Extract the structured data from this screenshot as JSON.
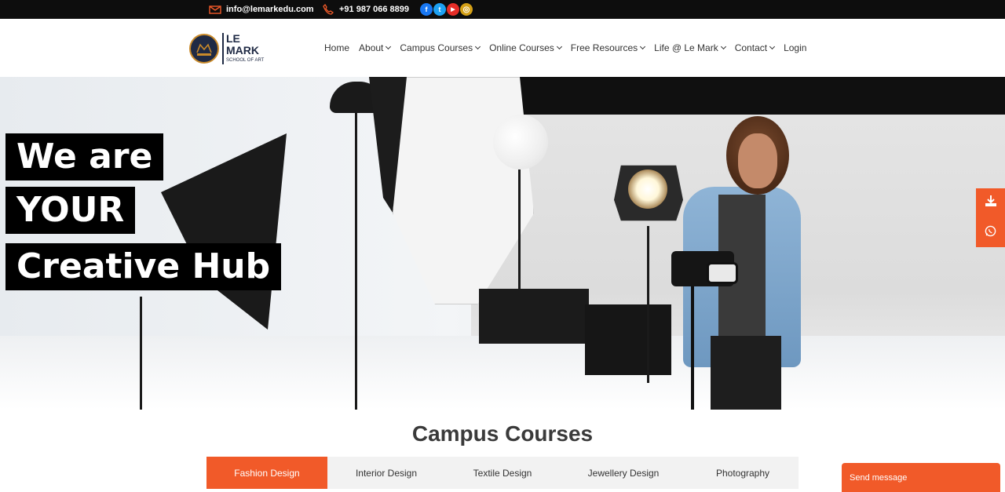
{
  "topbar": {
    "email": "info@lemarkedu.com",
    "phone": "+91 987 066 8899",
    "email_icon": "envelope-icon",
    "phone_icon": "phone-icon",
    "socials": [
      {
        "icon": "facebook-icon",
        "glyph": "f",
        "color": "#1877f2"
      },
      {
        "icon": "twitter-icon",
        "glyph": "t",
        "color": "#1da1f2"
      },
      {
        "icon": "youtube-icon",
        "glyph": "▶",
        "color": "#e52d27"
      },
      {
        "icon": "instagram-icon",
        "glyph": "◎",
        "color": "#d4a017"
      }
    ]
  },
  "logo": {
    "line1": "LE",
    "line2": "MARK",
    "tagline": "SCHOOL OF ART"
  },
  "nav": {
    "items": [
      {
        "label": "Home",
        "dropdown": false
      },
      {
        "label": "About",
        "dropdown": true
      },
      {
        "label": "Campus Courses",
        "dropdown": true
      },
      {
        "label": "Online Courses",
        "dropdown": true
      },
      {
        "label": "Free Resources",
        "dropdown": true
      },
      {
        "label": "Life @ Le Mark",
        "dropdown": true
      },
      {
        "label": "Contact",
        "dropdown": true
      },
      {
        "label": "Login",
        "dropdown": false
      }
    ]
  },
  "hero": {
    "lines": [
      "We are",
      "YOUR",
      "Creative Hub"
    ]
  },
  "floating": {
    "download_icon": "download-icon",
    "whatsapp_icon": "whatsapp-icon"
  },
  "courses": {
    "title": "Campus Courses",
    "tabs": [
      {
        "label": "Fashion Design",
        "active": true
      },
      {
        "label": "Interior Design",
        "active": false
      },
      {
        "label": "Textile Design",
        "active": false
      },
      {
        "label": "Jewellery Design",
        "active": false
      },
      {
        "label": "Photography",
        "active": false
      }
    ]
  },
  "chat": {
    "label": "Send message"
  },
  "colors": {
    "accent": "#f15a29",
    "topbar": "#0d0d0d",
    "brand": "#1f2a44"
  }
}
